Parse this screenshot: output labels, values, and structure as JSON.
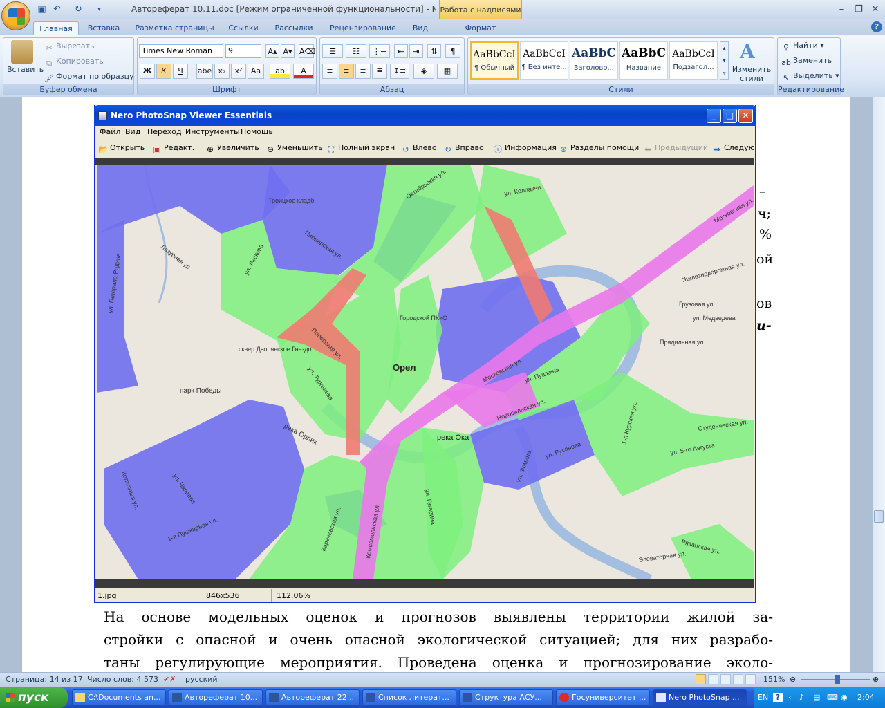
{
  "word": {
    "title": "Автореферат 10.11.doc [Режим ограниченной функциональности] - Micros...",
    "context_tab": "Работа с надписями",
    "tabs": [
      "Главная",
      "Вставка",
      "Разметка страницы",
      "Ссылки",
      "Рассылки",
      "Рецензирование",
      "Вид",
      "Формат"
    ],
    "clipboard": {
      "paste": "Вставить",
      "cut": "Вырезать",
      "copy": "Копировать",
      "format_painter": "Формат по образцу",
      "group": "Буфер обмена"
    },
    "font": {
      "name": "Times New Roman",
      "size": "9",
      "group": "Шрифт",
      "bold": "Ж",
      "italic": "К",
      "underline": "Ч",
      "strike": "abe",
      "sub": "x₂",
      "sup": "x²",
      "case": "Aa"
    },
    "paragraph": {
      "group": "Абзац"
    },
    "styles": {
      "group": "Стили",
      "change": "Изменить стили",
      "items": [
        {
          "sample": "AaBbCcI",
          "name": "¶ Обычный"
        },
        {
          "sample": "AaBbCcI",
          "name": "¶ Без инте..."
        },
        {
          "sample": "AaBbC",
          "name": "Заголово..."
        },
        {
          "sample": "AaBbC",
          "name": "Название"
        },
        {
          "sample": "AaBbCcI",
          "name": "Подзагол..."
        }
      ]
    },
    "editing": {
      "find": "Найти",
      "replace": "Заменить",
      "select": "Выделить",
      "group": "Редактирование"
    },
    "statusbar": {
      "page": "Страница: 14 из 17",
      "words": "Число слов: 4 573",
      "lang": "русский",
      "zoom": "151%"
    },
    "doc_fragments": [
      "–",
      "ч;",
      "%",
      "ой",
      "ов",
      "и-"
    ],
    "paragraph_lines": [
      "На основе модельных оценок и прогнозов выявлены территории жилой за-",
      "стройки с опасной и очень опасной экологической ситуацией; для них разрабо-",
      "таны регулирующие мероприятия. Проведена оценка и прогнозирование эколо-"
    ]
  },
  "nero": {
    "title": "Nero PhotoSnap Viewer Essentials",
    "menu": [
      "Файл",
      "Вид",
      "Переход",
      "Инструменты",
      "Помощь"
    ],
    "toolbar": [
      {
        "label": "Открыть",
        "icon": "open-folder-icon"
      },
      {
        "label": "Редакт.",
        "icon": "edit-icon"
      },
      {
        "label": "Увеличить",
        "icon": "zoom-in-icon"
      },
      {
        "label": "Уменьшить",
        "icon": "zoom-out-icon"
      },
      {
        "label": "Полный экран",
        "icon": "fullscreen-icon"
      },
      {
        "label": "Влево",
        "icon": "rotate-left-icon"
      },
      {
        "label": "Вправо",
        "icon": "rotate-right-icon"
      },
      {
        "label": "Информация",
        "icon": "info-icon"
      },
      {
        "label": "Разделы помощи",
        "icon": "help-topics-icon"
      },
      {
        "label": "Предыдущий",
        "icon": "prev-arrow-icon"
      },
      {
        "label": "Следую",
        "icon": "next-arrow-icon"
      }
    ],
    "status": {
      "file": "1.jpg",
      "dims": "846x536",
      "zoom": "112.06%"
    }
  },
  "map": {
    "labels": {
      "orel": "Орел",
      "oka": "река Ока",
      "orlik": "река Орлик",
      "park": "парк Победы",
      "skver": "сквер Дворянское Гнездо",
      "pkio": "Городской ПКиО",
      "cemetery": "Троицкое кладб.",
      "moskovskaya1": "Московская ул.",
      "moskovskaya2": "Московская ул.",
      "rusanova": "ул. Русанова",
      "fomina": "ул. Фомина",
      "pushkina": "ул. Пушкина",
      "novosilskaya": "Новосильская ул.",
      "studencheskaya": "Студенческая ул.",
      "avgusta": "ул. 5-го Августа",
      "gruzovaya": "Грузовая ул.",
      "pradilnaya": "Прядильная ул.",
      "zhd": "Железнодорожная ул.",
      "pushkarnaya": "1-я Пушкарная ул.",
      "chapaeva": "ул. Чапаева",
      "turgeneva": "ул. Тургенева",
      "polesskaya": "Полесская ул.",
      "leskova": "ул. Лескова",
      "pionerskaya": "Пионерская ул.",
      "oktyabrskaya": "Октябрьская ул.",
      "karachevskaya": "Карачевская ул.",
      "gagarina": "ул. Гагарина",
      "komsomolskaya": "Комсомольская ул.",
      "kolpakchi": "ул. Колпакчи",
      "generala": "ул. Генерала Родина",
      "lazurnaya": "Лазурная ул.",
      "kolhoznaya": "Колхозная ул.",
      "elevatornaya": "Элеваторная ул.",
      "medvedeva": "ул. Медведева",
      "ryazanskaya": "Рязанская ул.",
      "kurskaya": "1-я Курская ул."
    },
    "zone_colors": {
      "blue": "#6f6ff0",
      "green": "#7ef07e",
      "red": "#f07a72",
      "magenta": "#ea78ea",
      "river": "#a3bede",
      "base": "#ebe7de"
    }
  },
  "taskbar": {
    "start": "пуск",
    "tasks": [
      "C:\\Documents an...",
      "Автореферат 10...",
      "Автореферат 22...",
      "Список литерат...",
      "Структура АСУ...",
      "Госуниверситет ...",
      "Nero PhotoSnap ..."
    ],
    "lang": "EN",
    "clock": "2:04"
  }
}
